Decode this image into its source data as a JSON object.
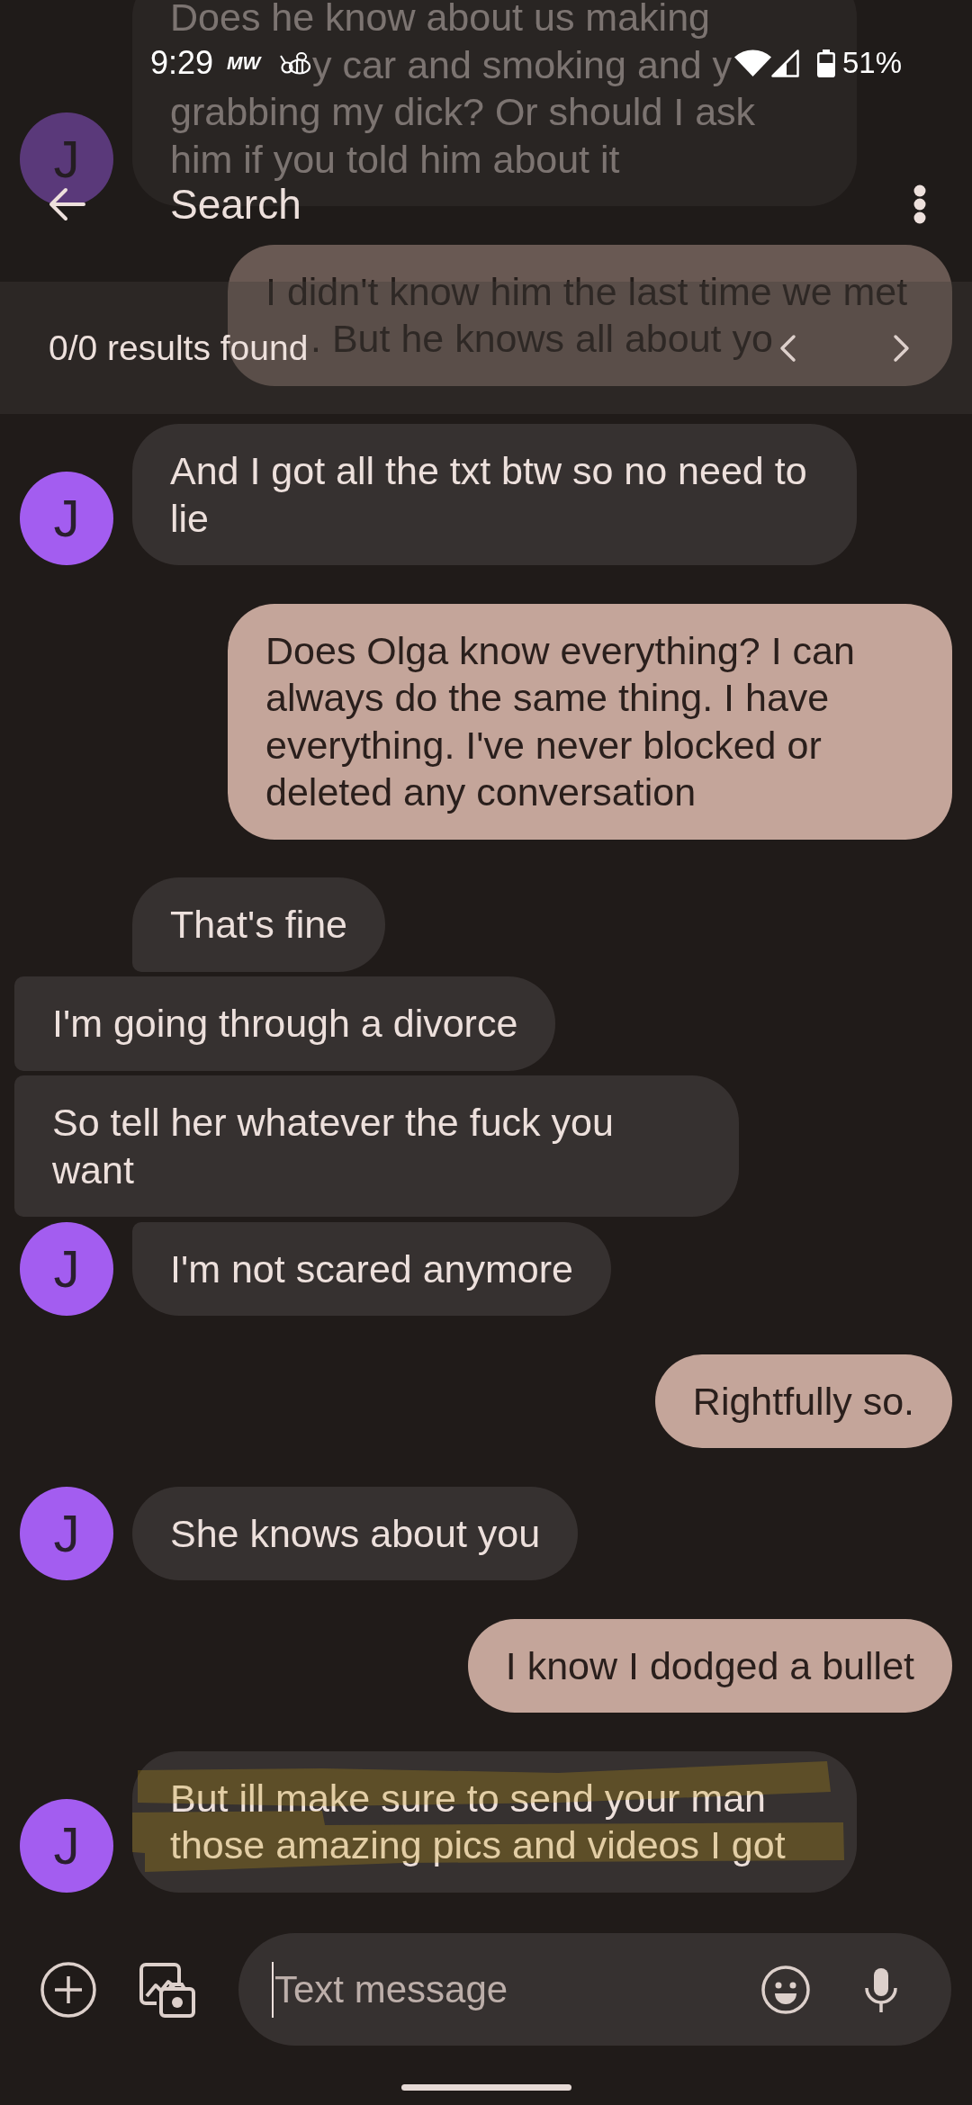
{
  "status_bar": {
    "time": "9:29",
    "notification_label": "MW",
    "battery_percent": "51%"
  },
  "app_bar": {
    "title": "Search"
  },
  "search_results": {
    "summary": "0/0 results found"
  },
  "messages": [
    {
      "kind": "incoming",
      "avatar": "J",
      "shifted": false,
      "highlighted": false,
      "lines": [
        {
          "kind": "whole",
          "text": "Does he know about us making"
        },
        {
          "kind": "tail",
          "text": "y car and smoking and y"
        },
        {
          "kind": "whole",
          "text": "grabbing my dick? Or should I ask"
        },
        {
          "kind": "whole",
          "text": "him if you told him about it"
        }
      ]
    },
    {
      "kind": "outgoing",
      "shifted": false,
      "highlighted": false,
      "lines": [
        {
          "kind": "whole",
          "text": "I didn't know him the last time we met"
        },
        {
          "kind": "tail",
          "text": ". But he knows all about yo"
        }
      ]
    },
    {
      "kind": "incoming",
      "avatar": "J",
      "shifted": false,
      "highlighted": false,
      "text": "And I got all the txt btw so no need to lie"
    },
    {
      "kind": "outgoing",
      "shifted": false,
      "highlighted": false,
      "text": "Does Olga know everything? I can always do the same thing. I have everything. I've never blocked or deleted any conversation"
    },
    {
      "kind": "incoming",
      "shifted": false,
      "highlighted": false,
      "text": "That's fine"
    },
    {
      "kind": "incoming",
      "shifted": true,
      "highlighted": false,
      "text": "I'm going through a divorce"
    },
    {
      "kind": "incoming",
      "shifted": true,
      "highlighted": false,
      "text": "So tell her whatever the fuck you want"
    },
    {
      "kind": "incoming",
      "avatar": "J",
      "shifted": false,
      "highlighted": false,
      "text": "I'm not scared anymore"
    },
    {
      "kind": "outgoing",
      "shifted": false,
      "highlighted": false,
      "text": "Rightfully so."
    },
    {
      "kind": "incoming",
      "avatar": "J",
      "shifted": false,
      "highlighted": false,
      "text": "She knows about you"
    },
    {
      "kind": "outgoing",
      "shifted": false,
      "highlighted": false,
      "text": "I know I dodged a bullet"
    },
    {
      "kind": "incoming",
      "avatar": "J",
      "shifted": false,
      "highlighted": true,
      "text": "But ill make sure to send your man those amazing pics and videos I got"
    }
  ],
  "composer": {
    "placeholder": "Text message"
  }
}
